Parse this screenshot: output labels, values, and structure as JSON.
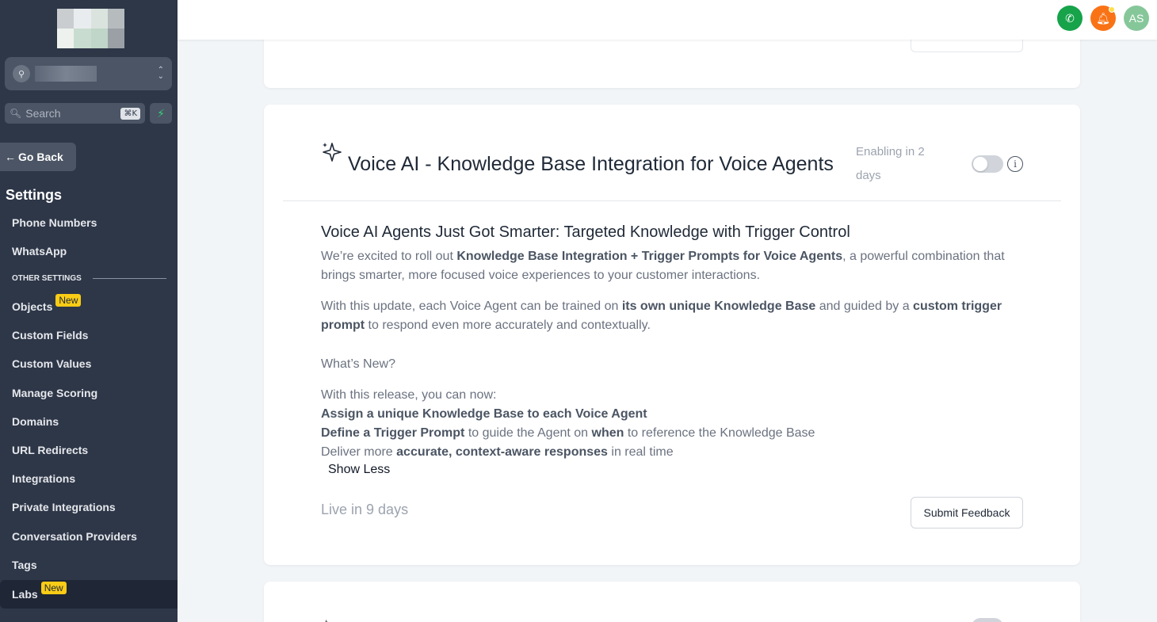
{
  "sidebar": {
    "search": {
      "placeholder": "Search",
      "shortcut": "⌘K"
    },
    "go_back": "Go Back",
    "settings_title": "Settings",
    "items_top": [
      {
        "label": "Phone Numbers"
      },
      {
        "label": "WhatsApp"
      }
    ],
    "other_settings_label": "OTHER SETTINGS",
    "items": [
      {
        "label": "Objects",
        "badge": "New"
      },
      {
        "label": "Custom Fields"
      },
      {
        "label": "Custom Values"
      },
      {
        "label": "Manage Scoring"
      },
      {
        "label": "Domains"
      },
      {
        "label": "URL Redirects"
      },
      {
        "label": "Integrations"
      },
      {
        "label": "Private Integrations"
      },
      {
        "label": "Conversation Providers"
      },
      {
        "label": "Tags"
      },
      {
        "label": "Labs",
        "badge": "New",
        "active": true
      }
    ]
  },
  "topbar": {
    "avatar_initials": "AS",
    "colors": {
      "phone": "#16a34a",
      "bell": "#f97316",
      "avatar": "#86c79a"
    }
  },
  "card": {
    "title": "Voice AI - Knowledge Base Integration for Voice Agents",
    "enabling": "Enabling in 2 days",
    "toggle_on": false,
    "headline": "Voice AI Agents Just Got Smarter: Targeted Knowledge with Trigger Control",
    "p1": {
      "a": "We’re excited to roll out ",
      "b": "Knowledge Base Integration + Trigger Prompts for Voice Agents",
      "c": ", a powerful combination that brings smarter, more focused voice experiences to your customer interactions."
    },
    "p2": {
      "a": "With this update, each Voice Agent can be trained on ",
      "b": "its own unique Knowledge Base",
      "c": " and guided by a ",
      "d": "custom trigger prompt",
      "e": " to respond even more accurately and contextually."
    },
    "whats_new": "What’s New?",
    "release_intro": "With this release, you can now:",
    "li1": {
      "b": "Assign a unique Knowledge Base to each Voice Agent"
    },
    "li2": {
      "b1": "Define a Trigger Prompt",
      "a": " to guide the Agent on ",
      "b2": "when",
      "c": " to reference the Knowledge Base"
    },
    "li3": {
      "a": "Deliver more ",
      "b": "accurate, context-aware responses",
      "c": " in real time"
    },
    "show_less": "Show Less",
    "live": "Live in 9 days",
    "submit_feedback": "Submit Feedback"
  }
}
